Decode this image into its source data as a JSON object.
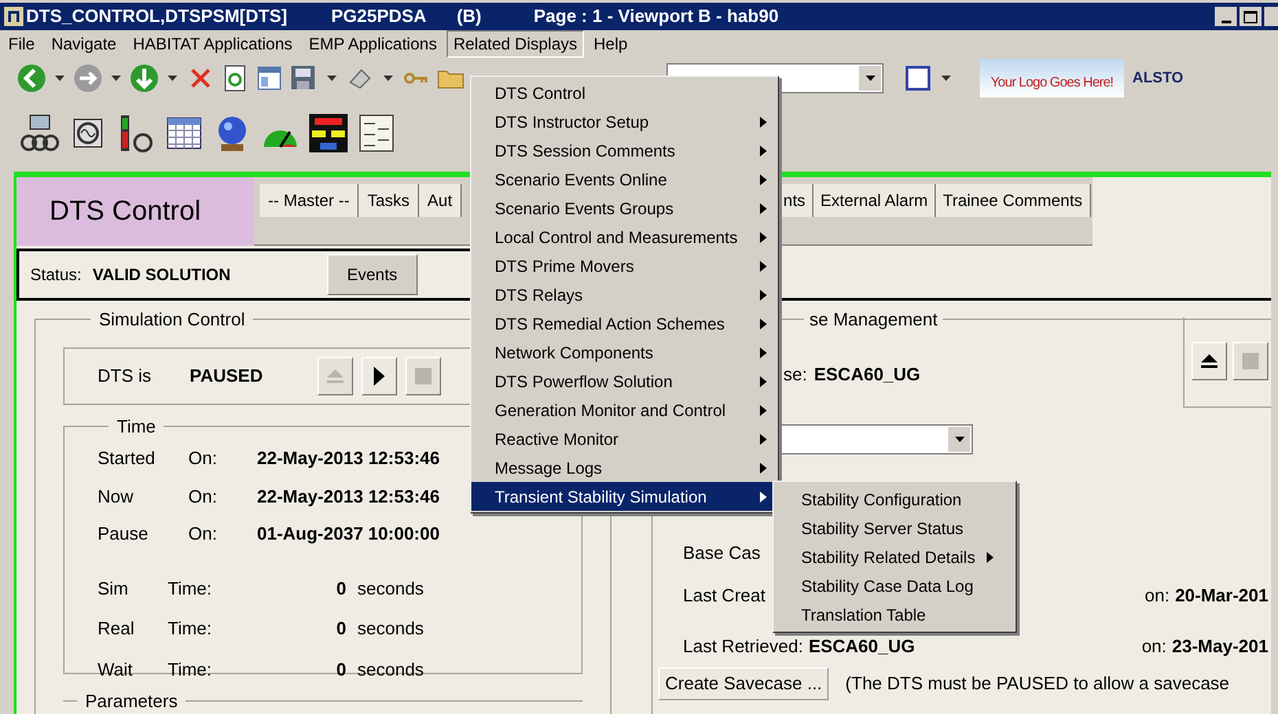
{
  "window": {
    "title_parts": [
      "DTS_CONTROL,DTSPSM[DTS]",
      "PG25PDSA",
      "(B)",
      "Page : 1 - Viewport B - hab90"
    ]
  },
  "menu_bar": [
    {
      "label": "File",
      "selected": false
    },
    {
      "label": "Navigate",
      "selected": false
    },
    {
      "label": "HABITAT Applications",
      "selected": false
    },
    {
      "label": "EMP Applications",
      "selected": false
    },
    {
      "label": "Related Displays",
      "selected": true
    },
    {
      "label": "Help",
      "selected": false
    }
  ],
  "toolbar": {
    "logo_text": "Your Logo Goes Here!",
    "brand_text": "ALSTO"
  },
  "header": {
    "title": "DTS Control",
    "tabs": [
      "-- Master --",
      "Tasks",
      "Aut"
    ],
    "tabs_continued": [
      "nts",
      "External Alarm",
      "Trainee Comments"
    ]
  },
  "status": {
    "label": "Status:",
    "value": "VALID SOLUTION",
    "button": "Events"
  },
  "simulation_control": {
    "title": "Simulation Control",
    "state_label": "DTS is",
    "state": "PAUSED",
    "controls": [
      {
        "kind": "eject",
        "disabled": true
      },
      {
        "kind": "play",
        "disabled": false
      },
      {
        "kind": "stop",
        "disabled": true
      }
    ]
  },
  "time": {
    "title": "Time",
    "dates": [
      {
        "label": "Started",
        "on": "On:",
        "value": "22-May-2013 12:53:46"
      },
      {
        "label": "Now",
        "on": "On:",
        "value": "22-May-2013 12:53:46"
      },
      {
        "label": "Pause",
        "on": "On:",
        "value": "01-Aug-2037 10:00:00"
      }
    ],
    "durations": [
      {
        "label": "Sim",
        "time": "Time:",
        "value": "0",
        "unit": "seconds"
      },
      {
        "label": "Real",
        "time": "Time:",
        "value": "0",
        "unit": "seconds"
      },
      {
        "label": "Wait",
        "time": "Time:",
        "value": "0",
        "unit": "seconds"
      }
    ]
  },
  "parameters": {
    "title": "Parameters"
  },
  "case_management": {
    "title": "se Management",
    "in_use_label": "se:",
    "in_use": "ESCA60_UG",
    "controls": [
      {
        "kind": "eject",
        "disabled": false
      },
      {
        "kind": "stop",
        "disabled": true
      }
    ],
    "base_case_label": "Base Cas",
    "last_created_label": "Last Creat",
    "last_created_on": "on:",
    "last_created_date": "20-Mar-201",
    "last_retrieved_label": "Last Retrieved:",
    "last_retrieved": "ESCA60_UG",
    "last_retrieved_on": "on:",
    "last_retrieved_date": "23-May-201",
    "create_button": "Create Savecase ...",
    "note": "(The DTS must be PAUSED to allow a savecase"
  },
  "related_menu": [
    {
      "label": "DTS Control",
      "has_submenu": false,
      "selected": false
    },
    {
      "label": "DTS Instructor Setup",
      "has_submenu": true,
      "selected": false
    },
    {
      "label": "DTS Session Comments",
      "has_submenu": true,
      "selected": false
    },
    {
      "label": "Scenario Events Online",
      "has_submenu": true,
      "selected": false
    },
    {
      "label": "Scenario Events Groups",
      "has_submenu": true,
      "selected": false
    },
    {
      "label": "Local Control and Measurements",
      "has_submenu": true,
      "selected": false
    },
    {
      "label": "DTS Prime Movers",
      "has_submenu": true,
      "selected": false
    },
    {
      "label": "DTS Relays",
      "has_submenu": true,
      "selected": false
    },
    {
      "label": "DTS Remedial Action Schemes",
      "has_submenu": true,
      "selected": false
    },
    {
      "label": "Network Components",
      "has_submenu": true,
      "selected": false
    },
    {
      "label": "DTS Powerflow Solution",
      "has_submenu": true,
      "selected": false
    },
    {
      "label": "Generation Monitor and Control",
      "has_submenu": true,
      "selected": false
    },
    {
      "label": "Reactive Monitor",
      "has_submenu": true,
      "selected": false
    },
    {
      "label": "Message Logs",
      "has_submenu": true,
      "selected": false
    },
    {
      "label": "Transient Stability Simulation",
      "has_submenu": true,
      "selected": true
    }
  ],
  "submenu": [
    {
      "label": "Stability Configuration",
      "has_submenu": false
    },
    {
      "label": "Stability Server Status",
      "has_submenu": false
    },
    {
      "label": "Stability Related Details",
      "has_submenu": true
    },
    {
      "label": "Stability Case Data Log",
      "has_submenu": false
    },
    {
      "label": "Translation Table",
      "has_submenu": false
    }
  ]
}
